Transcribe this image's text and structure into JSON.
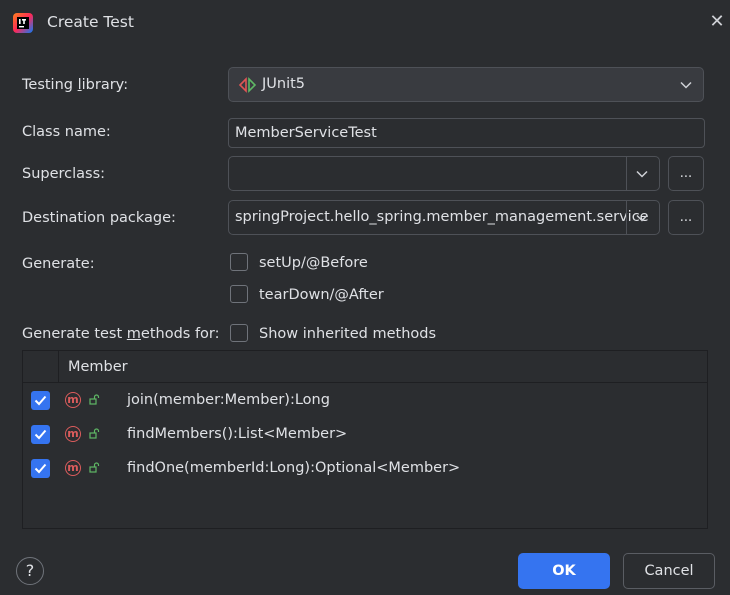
{
  "window": {
    "title": "Create Test"
  },
  "form": {
    "testing_library": {
      "label_pre": "Testing ",
      "label_u": "l",
      "label_post": "ibrary:",
      "value": "JUnit5"
    },
    "class_name": {
      "label": "Class name:",
      "value": "MemberServiceTest"
    },
    "superclass": {
      "label": "Superclass:",
      "value": "",
      "browse": "..."
    },
    "destination": {
      "label": "Destination package:",
      "value": "springProject.hello_spring.member_management.service",
      "browse": "..."
    },
    "generate": {
      "label": "Generate:",
      "setup": "setUp/@Before",
      "teardown": "tearDown/@After",
      "setup_checked": false,
      "teardown_checked": false
    },
    "methods_for": {
      "label_pre": "Generate test ",
      "label_u": "m",
      "label_post": "ethods for:",
      "show_inherited": "Show inherited methods",
      "show_inherited_checked": false
    }
  },
  "table": {
    "column": "Member",
    "rows": [
      {
        "checked": true,
        "icon": "method-icon",
        "modifier": "public",
        "signature": "join(member:Member):Long"
      },
      {
        "checked": true,
        "icon": "method-icon",
        "modifier": "public",
        "signature": "findMembers():List<Member>"
      },
      {
        "checked": true,
        "icon": "method-icon",
        "modifier": "public",
        "signature": "findOne(memberId:Long):Optional<Member>"
      }
    ]
  },
  "footer": {
    "help": "?",
    "ok": "OK",
    "cancel": "Cancel"
  },
  "colors": {
    "bg": "#2b2d30",
    "accent": "#3574f0",
    "method": "#db5c5c",
    "public": "#5fb865",
    "junit_red": "#e05555",
    "junit_green": "#5fb865"
  }
}
